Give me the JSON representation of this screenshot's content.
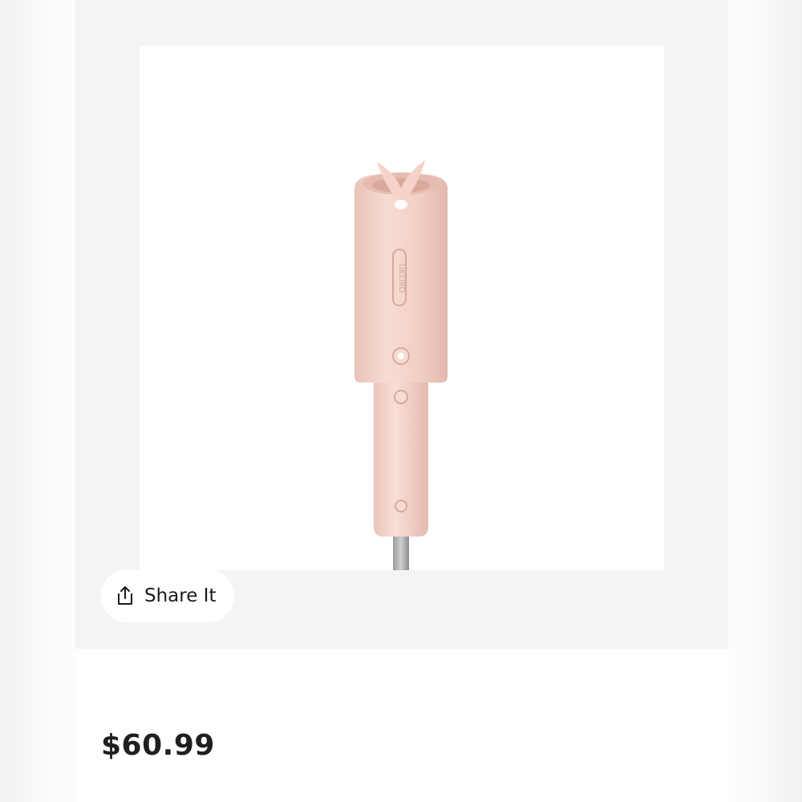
{
  "product": {
    "image_alt": "Pink automatic hair curler",
    "price": "$60.99",
    "brand_mark": "UKLIKO"
  },
  "actions": {
    "share_label": "Share It",
    "share_icon": "share-upload-icon"
  },
  "colors": {
    "page_bg": "#f4f4f4",
    "card_bg": "#ffffff",
    "text": "#1f1f1f",
    "product_pink": "#f2d2c8"
  }
}
